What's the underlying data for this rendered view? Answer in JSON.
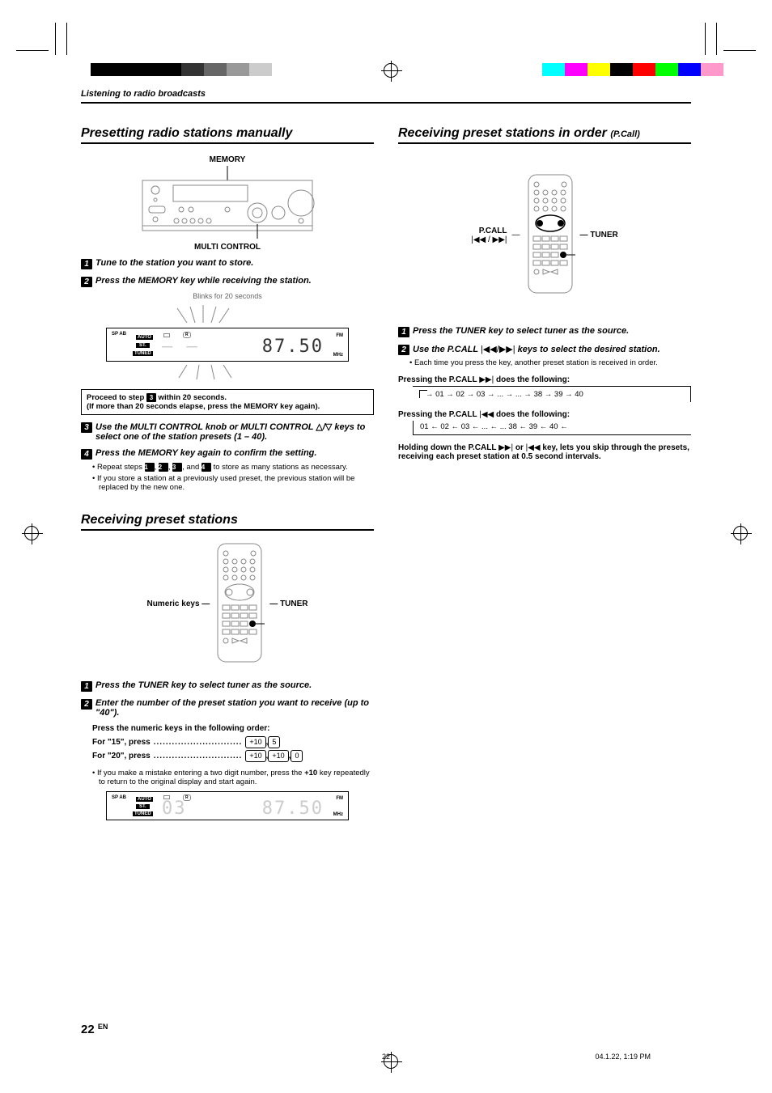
{
  "breadcrumb": "Listening to radio broadcasts",
  "left": {
    "h1": "Presetting radio stations manually",
    "diag_top": "MEMORY",
    "diag_bot": "MULTI CONTROL",
    "step1": "Tune to the station you want to store.",
    "step2": "Press the MEMORY key while receiving the station.",
    "blink_caption": "Blinks for 20 seconds",
    "proceed_l1": "Proceed to step 3 within 20 seconds.",
    "proceed_l2": "(If more than 20 seconds elapse, press the MEMORY key again).",
    "step3": "Use the MULTI  CONTROL knob or MULTI CONTROL △/▽ keys to select one of the station presets (1 – 40).",
    "step4": "Press the MEMORY key  again to confirm the setting.",
    "bullet_a": "Repeat steps 1, 2, 3, and 4 to store as many stations as necessary.",
    "bullet_b": "If you store a station at a previously used preset, the previous station will be replaced by the new one.",
    "h2": "Receiving preset stations",
    "remote_left": "Numeric keys",
    "remote_right": "TUNER",
    "r_step1": "Press the TUNER key to select tuner as the source.",
    "r_step2": "Enter the number of the preset station you want to receive (up to \"40\").",
    "press_header": "Press the numeric keys in the following order:",
    "press_15_label": "For \"15\", press",
    "press_15_keys": [
      "+10",
      "5"
    ],
    "press_20_label": "For \"20\", press",
    "press_20_keys": [
      "+10",
      "+10",
      "0"
    ],
    "mistake": "If you make a mistake entering a two digit number, press the +10 key repeatedly to return to the original display and start again."
  },
  "right": {
    "h1": "Receiving preset stations in order",
    "h1_sub": "(P.Call)",
    "remote_left1": "P.CALL",
    "remote_left2_glyph": "|◀◀ / ▶▶|",
    "remote_right": "TUNER",
    "step1": "Press the TUNER key to select tuner as the source.",
    "step2_pre": "Use the P.CALL ",
    "step2_glyph": "|◀◀/▶▶|",
    "step2_post": " keys to select the desired station.",
    "bullet": "Each time you press the key, another preset station is received in order.",
    "fwd_label_pre": "Pressing the P.CALL ",
    "fwd_label_glyph": "▶▶|",
    "fwd_label_post": " does the following:",
    "fwd_seq": "01 → 02 → 03 → ... → ... → 38 → 39 → 40",
    "rev_label_pre": "Pressing the P.CALL ",
    "rev_label_glyph": "|◀◀",
    "rev_label_post": " does the following:",
    "rev_seq": "01 ← 02 ← 03 ← ... ← ... 38 ← 39 ← 40 ←",
    "hold_pre": "Holding down the P.CALL ",
    "hold_glyph1": "▶▶|",
    "hold_mid": " or ",
    "hold_glyph2": "|◀◀",
    "hold_post": " key, lets you skip through the presets, receiving each preset station at 0.5 second intervals."
  },
  "display1": {
    "sp": "SP AB",
    "auto": "AUTO",
    "st": "ST.",
    "tuned": "TUNED",
    "preset": "– –",
    "freq": "87.50",
    "band": "FM",
    "unit": "MHz"
  },
  "display2": {
    "sp": "SP AB",
    "auto": "AUTO",
    "st": "ST.",
    "tuned": "TUNED",
    "preset": "03",
    "freq": "87.50",
    "band": "FM",
    "unit": "MHz"
  },
  "page_number": "22",
  "page_lang": "EN",
  "footer_center": "22",
  "footer_right": "04.1.22, 1:19 PM"
}
